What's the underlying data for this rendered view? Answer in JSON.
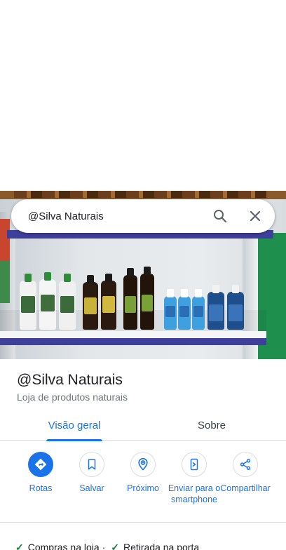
{
  "search": {
    "query": "@Silva Naturais"
  },
  "place": {
    "title": "@Silva Naturais",
    "category": "Loja de produtos naturais"
  },
  "tabs": [
    {
      "label": "Visão geral",
      "selected": true
    },
    {
      "label": "Sobre",
      "selected": false
    }
  ],
  "actions": [
    {
      "label": "Rotas",
      "icon": "directions-icon"
    },
    {
      "label": "Salvar",
      "icon": "bookmark-icon"
    },
    {
      "label": "Próximo",
      "icon": "nearby-icon"
    },
    {
      "label": "Enviar para o smartphone",
      "icon": "send-to-phone-icon"
    },
    {
      "label": "Compartilhar",
      "icon": "share-icon"
    }
  ],
  "features": [
    {
      "label": "Compras na loja"
    },
    {
      "label": "Retirada na porta"
    }
  ],
  "colors": {
    "accent": "#1a73e8",
    "check": "#188038"
  }
}
